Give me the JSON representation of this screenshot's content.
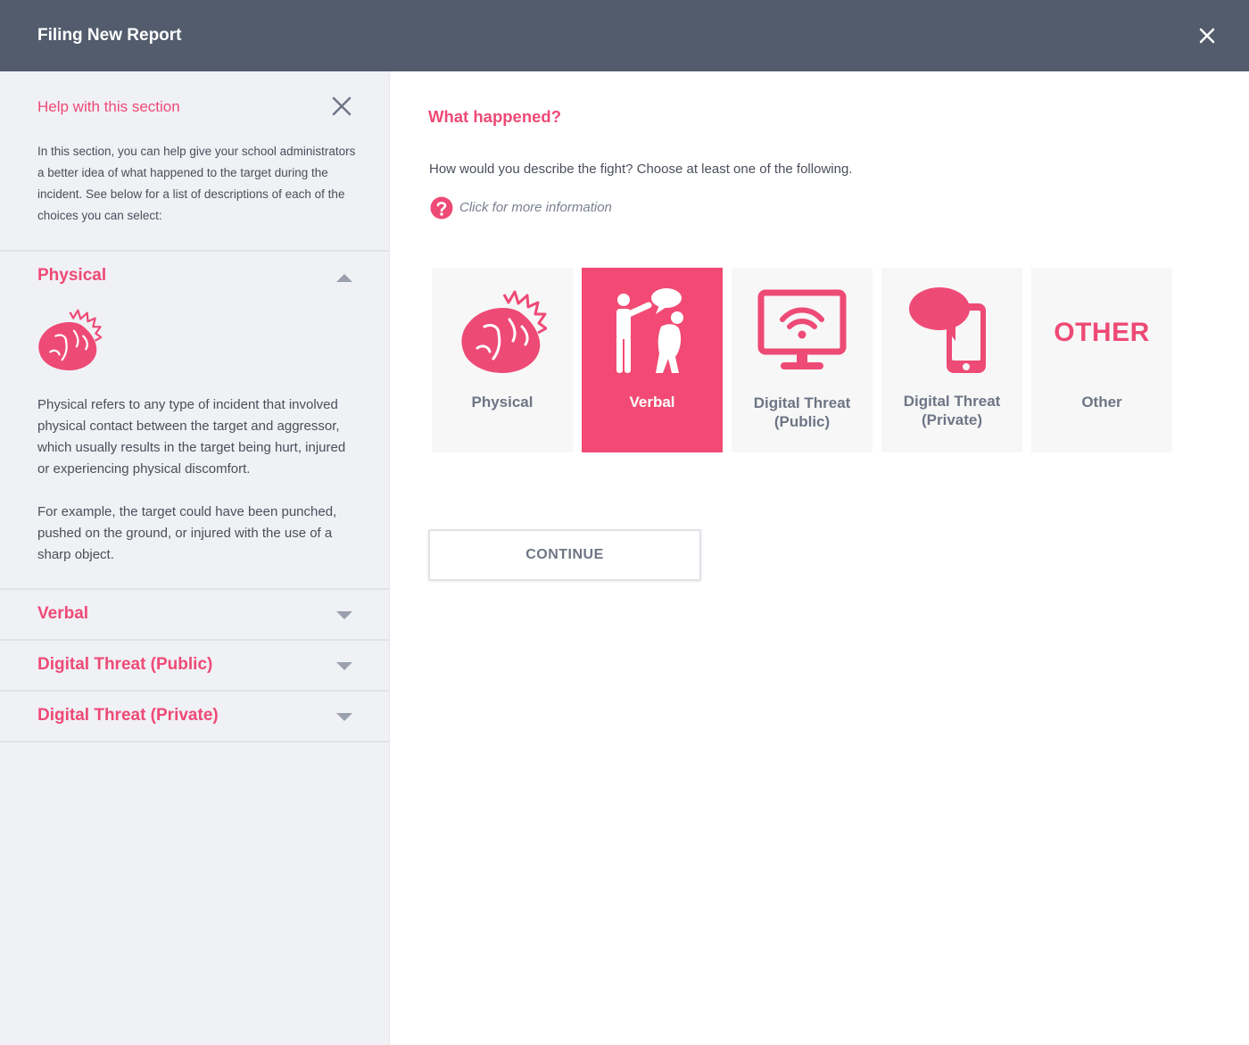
{
  "header": {
    "title": "Filing New Report",
    "close_icon": "close-icon"
  },
  "help": {
    "title": "Help with this section",
    "description": "In this section, you can help give your school administrators a better idea of what happened to the target during the incident. See below for a list of descriptions of each of the choices you can select:",
    "sections": [
      {
        "label": "Physical",
        "expanded": true,
        "icon": "fist-icon",
        "paragraphs": [
          "Physical refers to any type of incident that involved physical contact between the target and aggressor, which usually results in the target being hurt, injured or experiencing physical discomfort.",
          "For example, the target could have been punched, pushed on the ground, or injured with the use of a sharp object."
        ]
      },
      {
        "label": "Verbal",
        "expanded": false
      },
      {
        "label": "Digital Threat (Public)",
        "expanded": false
      },
      {
        "label": "Digital Threat (Private)",
        "expanded": false
      }
    ]
  },
  "main": {
    "title": "What happened?",
    "description": "How would you describe the fight? Choose at least one of the following.",
    "info_link": "Click for more information",
    "options": [
      {
        "label": "Physical",
        "icon": "fist-icon",
        "selected": false
      },
      {
        "label": "Verbal",
        "icon": "verbal-speech-icon",
        "selected": true
      },
      {
        "label_line1": "Digital Threat",
        "label_line2": "(Public)",
        "icon": "monitor-wifi-icon",
        "selected": false
      },
      {
        "label_line1": "Digital Threat",
        "label_line2": "(Private)",
        "icon": "phone-chat-icon",
        "selected": false
      },
      {
        "label": "Other",
        "icon_text": "OTHER",
        "selected": false
      }
    ],
    "continue_label": "CONTINUE"
  },
  "colors": {
    "accent": "#ee4a76",
    "header_bg": "#525c6d",
    "sidebar_bg": "#f0f1f5",
    "card_bg": "#f7f7f7",
    "selected_bg": "#f24a74"
  }
}
